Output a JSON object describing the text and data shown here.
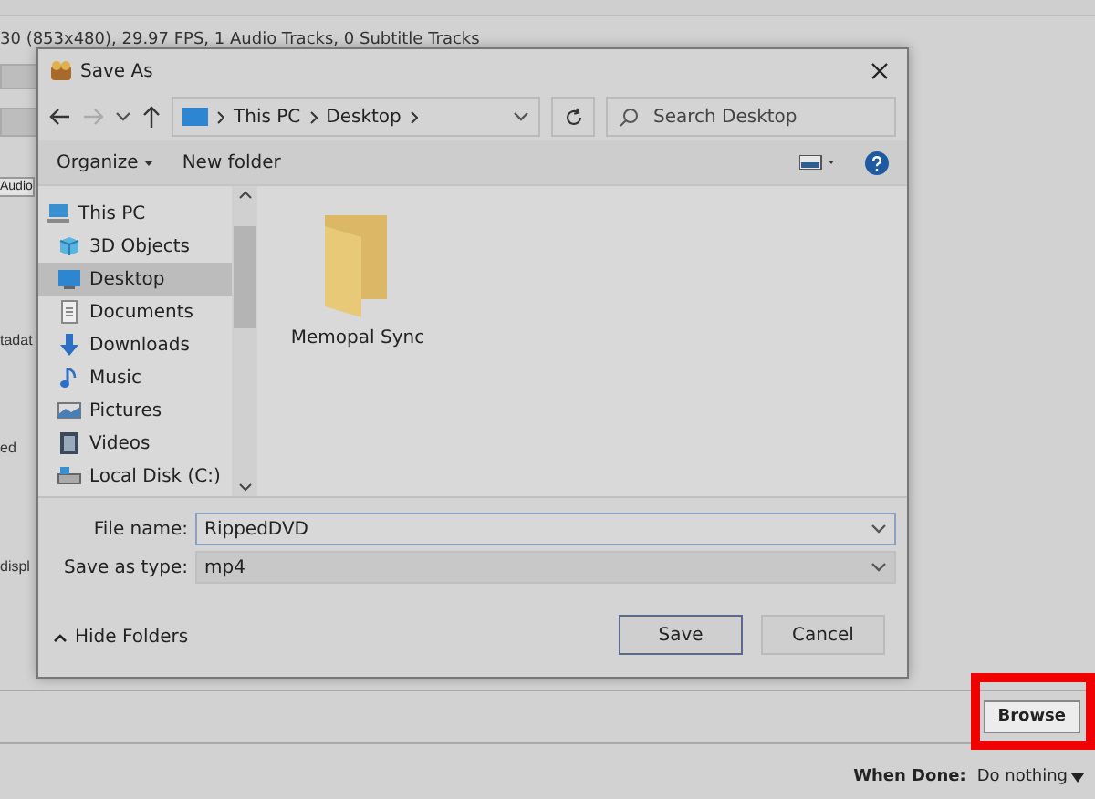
{
  "background_app": {
    "info_text": "30 (853x480), 29.97 FPS, 1 Audio Tracks, 0 Subtitle Tracks",
    "tab": "Audio",
    "side_labels": [
      "tadat",
      "ed",
      "displ"
    ],
    "browse_button": {
      "label": "Browse",
      "highlighted": true
    },
    "when_done": {
      "label": "When Done:",
      "value": "Do nothing"
    }
  },
  "dialog": {
    "title": "Save As",
    "address": [
      "This PC",
      "Desktop"
    ],
    "search": {
      "placeholder": "Search Desktop"
    },
    "toolbar": {
      "organize": "Organize",
      "new_folder": "New folder"
    },
    "nav_items": [
      {
        "label": "This PC",
        "kind": "pc",
        "selected": false
      },
      {
        "label": "3D Objects",
        "kind": "objects",
        "selected": false
      },
      {
        "label": "Desktop",
        "kind": "desktop",
        "selected": true
      },
      {
        "label": "Documents",
        "kind": "documents",
        "selected": false
      },
      {
        "label": "Downloads",
        "kind": "downloads",
        "selected": false
      },
      {
        "label": "Music",
        "kind": "music",
        "selected": false
      },
      {
        "label": "Pictures",
        "kind": "pictures",
        "selected": false
      },
      {
        "label": "Videos",
        "kind": "videos",
        "selected": false
      },
      {
        "label": "Local Disk (C:)",
        "kind": "disk",
        "selected": false
      }
    ],
    "files": [
      {
        "name": "Memopal Sync"
      }
    ],
    "file_name": {
      "label": "File name:",
      "value": "RippedDVD"
    },
    "save_type": {
      "label": "Save as type:",
      "value": "mp4"
    },
    "hide_folders": "Hide Folders",
    "buttons": [
      {
        "label": "Save",
        "default": true
      },
      {
        "label": "Cancel",
        "default": false
      }
    ]
  }
}
